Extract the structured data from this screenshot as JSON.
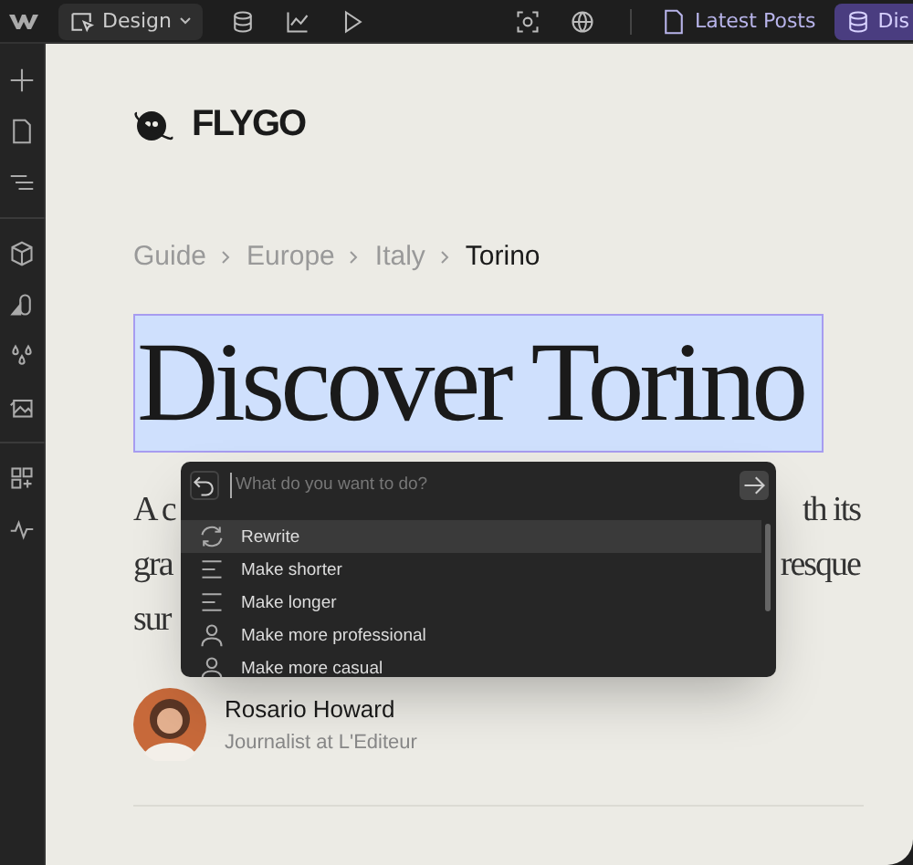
{
  "toolbar": {
    "mode_button": "Design",
    "tabs": [
      {
        "label": "Latest Posts",
        "kind": "page",
        "selected": false
      },
      {
        "label": "Dis",
        "kind": "database",
        "selected": true
      }
    ]
  },
  "site": {
    "logo": "FLYGO"
  },
  "breadcrumb": [
    {
      "label": "Guide",
      "current": false
    },
    {
      "label": "Europe",
      "current": false
    },
    {
      "label": "Italy",
      "current": false
    },
    {
      "label": "Torino",
      "current": true
    }
  ],
  "heading": {
    "text": "Discover Torino",
    "selected": true
  },
  "paragraph_lines": [
    {
      "left": "A c",
      "right": "th its"
    },
    {
      "left": "gra",
      "right": "resque"
    },
    {
      "left": "sur"
    }
  ],
  "ai_menu": {
    "placeholder": "What do you want to do?",
    "items": [
      {
        "label": "Rewrite",
        "kind": "rewrite",
        "selected": true
      },
      {
        "label": "Make shorter",
        "kind": "lines",
        "selected": false
      },
      {
        "label": "Make longer",
        "kind": "lines",
        "selected": false
      },
      {
        "label": "Make more professional",
        "kind": "person",
        "selected": false
      },
      {
        "label": "Make more casual",
        "kind": "person",
        "selected": false
      }
    ]
  },
  "author": {
    "name": "Rosario Howard",
    "role": "Journalist at L'Editeur"
  }
}
